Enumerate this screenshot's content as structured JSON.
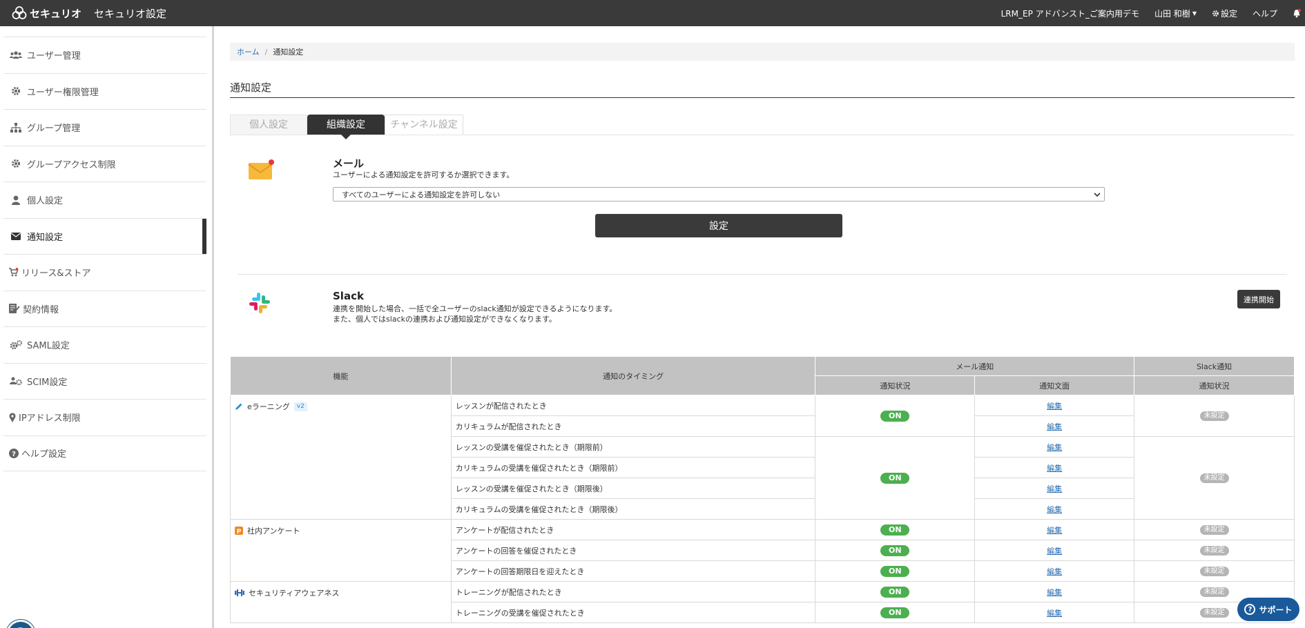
{
  "header": {
    "logo_text": "セキュリオ",
    "app_title": "セキュリオ設定",
    "org_name": "LRM_EP アドバンスト_ご案内用デモ",
    "user_name": "山田 和樹",
    "settings_label": "設定",
    "help_label": "ヘルプ"
  },
  "sidebar": {
    "items": [
      {
        "label": "ユーザー管理",
        "icon": "users-icon"
      },
      {
        "label": "ユーザー権限管理",
        "icon": "gear-icon"
      },
      {
        "label": "グループ管理",
        "icon": "sitemap-icon"
      },
      {
        "label": "グループアクセス制限",
        "icon": "gear-icon"
      },
      {
        "label": "個人設定",
        "icon": "user-icon"
      },
      {
        "label": "通知設定",
        "icon": "envelope-icon"
      },
      {
        "label": "リリース&ストア",
        "icon": "cart-icon"
      },
      {
        "label": "契約情報",
        "icon": "contract-icon"
      },
      {
        "label": "SAML設定",
        "icon": "gears-icon"
      },
      {
        "label": "SCIM設定",
        "icon": "users-gear-icon"
      },
      {
        "label": "IPアドレス制限",
        "icon": "map-pin-icon"
      },
      {
        "label": "ヘルプ設定",
        "icon": "question-circle-icon"
      }
    ]
  },
  "breadcrumb": {
    "home": "ホーム",
    "current": "通知設定"
  },
  "page": {
    "title": "通知設定"
  },
  "tabs": {
    "personal": "個人設定",
    "org": "組織設定",
    "channel": "チャンネル設定"
  },
  "mail": {
    "title": "メール",
    "description": "ユーザーによる通知設定を許可するか選択できます。",
    "select_value": "すべてのユーザーによる通知設定を許可しない",
    "submit": "設定"
  },
  "slack": {
    "title": "Slack",
    "desc1": "連携を開始した場合、一括で全ユーザーのslack通知が設定できるようになります。",
    "desc2": "また、個人ではslackの連携および通知設定ができなくなります。",
    "button": "連携開始"
  },
  "table": {
    "headers": {
      "feature": "機能",
      "timing": "通知のタイミング",
      "mail_group": "メール通知",
      "slack_group": "Slack通知",
      "status": "通知状況",
      "text": "通知文面",
      "slack_status": "通知状況"
    },
    "features": {
      "elearning": "eラーニング",
      "elearning_tag": "v2",
      "survey": "社内アンケート",
      "awareness": "セキュリティアウェアネス"
    },
    "timings": [
      "レッスンが配信されたとき",
      "カリキュラムが配信されたとき",
      "レッスンの受講を催促されたとき（期限前）",
      "カリキュラムの受講を催促されたとき（期限前）",
      "レッスンの受講を催促されたとき（期限後）",
      "カリキュラムの受講を催促されたとき（期限後）",
      "アンケートが配信されたとき",
      "アンケートの回答を催促されたとき",
      "アンケートの回答期限日を迎えたとき",
      "トレーニングが配信されたとき",
      "トレーニングの受講を催促されたとき"
    ],
    "on_label": "ON",
    "off_label": "未設定",
    "edit_label": "編集"
  },
  "support": {
    "label": "サポート"
  },
  "colors": {
    "topbar": "#3a3a3a",
    "on": "#4caf50",
    "off": "#b5b5b5",
    "link": "#2a6fb0",
    "support": "#1a5a9a"
  }
}
